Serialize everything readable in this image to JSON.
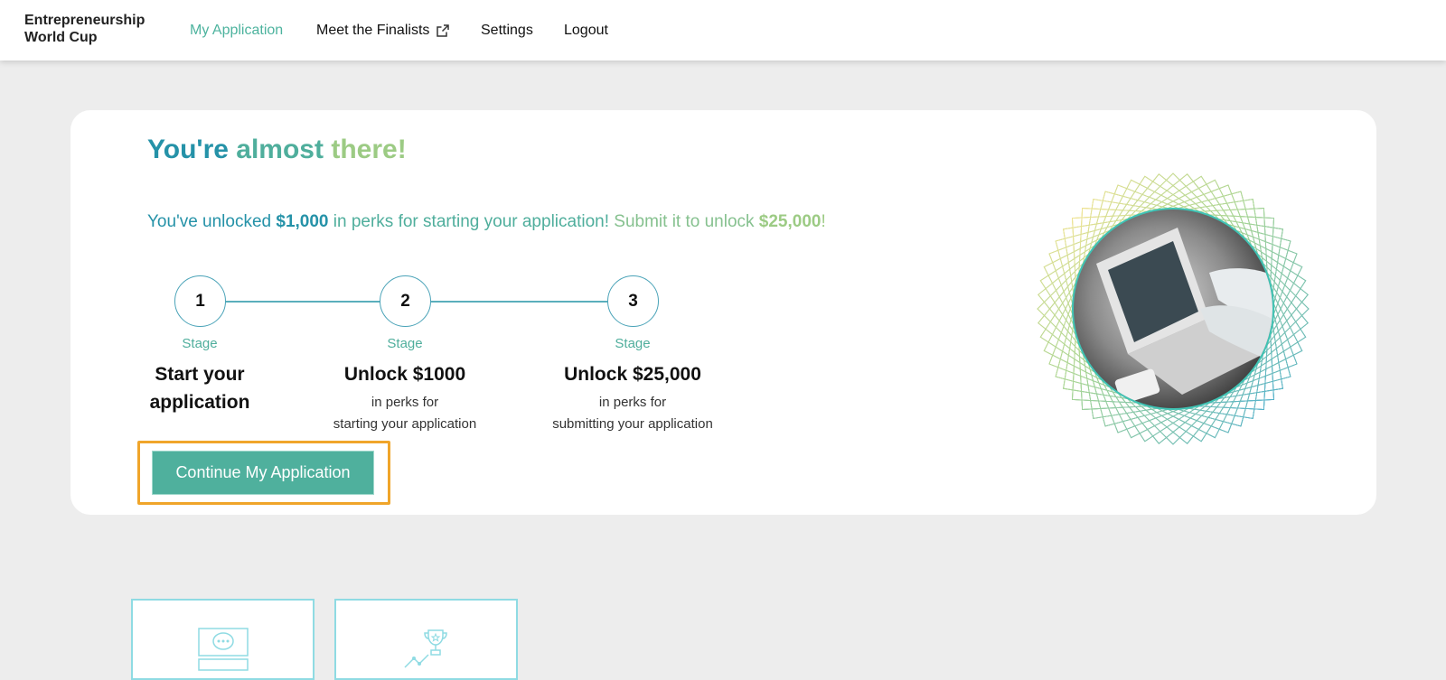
{
  "nav": {
    "brand": "Entrepreneurship\nWorld Cup",
    "links": [
      {
        "label": "My Application",
        "active": true
      },
      {
        "label": "Meet the Finalists",
        "external": true
      },
      {
        "label": "Settings"
      },
      {
        "label": "Logout"
      }
    ]
  },
  "hero": {
    "headline": [
      "You're",
      "almost",
      "there!"
    ],
    "perk_line": {
      "part1": "You've unlocked ",
      "amount1": "$1,000",
      "part2": " in perks for starting your application!",
      "part3": " Submit it to unlock ",
      "amount2": "$25,000",
      "part4": "!"
    },
    "steps": [
      {
        "number": "1",
        "stage": "Stage",
        "title": "Start your\napplication",
        "subtitle": ""
      },
      {
        "number": "2",
        "stage": "Stage",
        "title": "Unlock $1000",
        "subtitle": "in perks for\nstarting your application"
      },
      {
        "number": "3",
        "stage": "Stage",
        "title": "Unlock $25,000",
        "subtitle": "in perks for\nsubmitting your application"
      }
    ],
    "cta_label": "Continue My Application"
  },
  "colors": {
    "accent": "#4fb09d",
    "teal_dark": "#2592a8",
    "green_light": "#9ccb84",
    "focus": "#f0a52a"
  }
}
